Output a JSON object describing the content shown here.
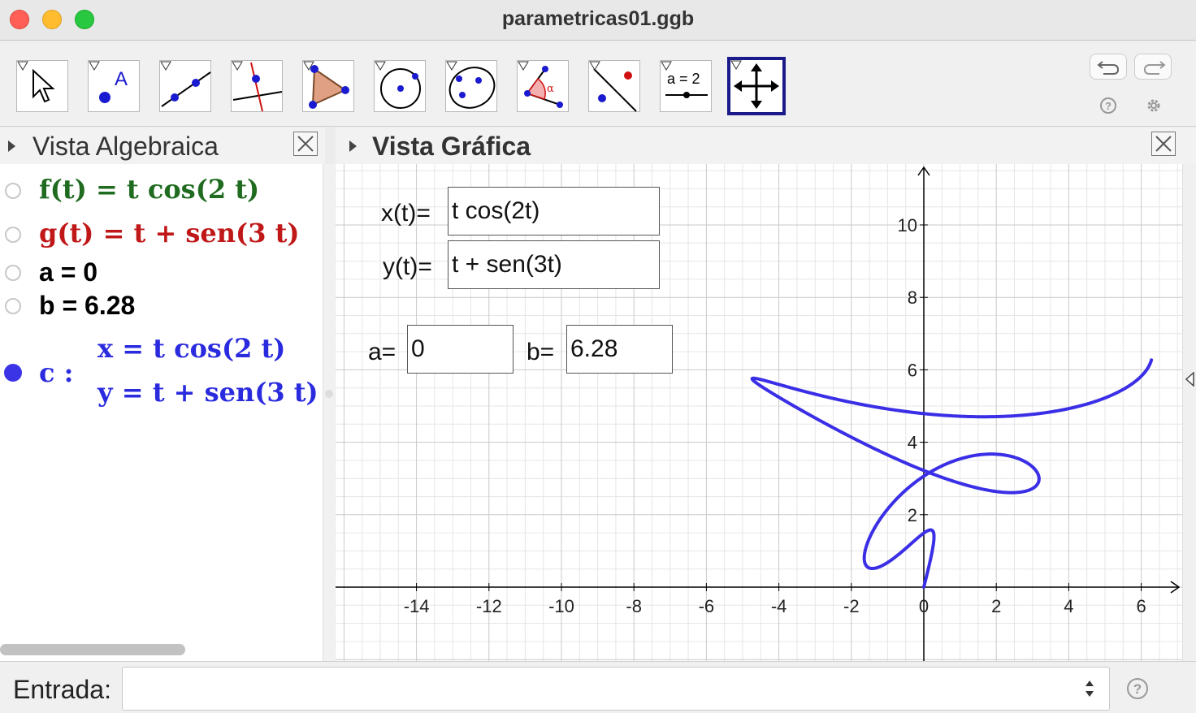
{
  "window": {
    "title": "parametricas01.ggb"
  },
  "toolbar": {
    "tools": [
      {
        "name": "move-tool",
        "selected": false
      },
      {
        "name": "point-tool",
        "selected": false
      },
      {
        "name": "line-tool",
        "selected": false
      },
      {
        "name": "perpendicular-line-tool",
        "selected": false
      },
      {
        "name": "polygon-tool",
        "selected": false
      },
      {
        "name": "circle-center-point-tool",
        "selected": false
      },
      {
        "name": "ellipse-tool",
        "selected": false
      },
      {
        "name": "angle-tool",
        "selected": false
      },
      {
        "name": "reflect-tool",
        "selected": false
      },
      {
        "name": "slider-tool",
        "selected": false
      },
      {
        "name": "move-graphics-view-tool",
        "selected": true
      }
    ],
    "slider_icon_text": "a = 2",
    "angle_icon_text": "α"
  },
  "algebra": {
    "title": "Vista Algebraica",
    "rows": [
      {
        "text": "f(t)  =  t  cos(2 t)",
        "color": "#1f6b1f"
      },
      {
        "text": "g(t)  =  t + sen(3 t)",
        "color": "#c01818"
      },
      {
        "text": "a = 0",
        "color": "#000000"
      },
      {
        "text": "b = 6.28",
        "color": "#000000"
      }
    ],
    "curve": {
      "label": "c :",
      "x": "x = t  cos(2 t)",
      "y": "y = t + sen(3 t)",
      "color": "#2a2adf"
    }
  },
  "graphics": {
    "title": "Vista Gráfica",
    "x_label": "x(t)=",
    "x_value": "t cos(2t)",
    "y_label": "y(t)=",
    "y_value": "t + sen(3t)",
    "a_label": "a=",
    "a_value": "0",
    "b_label": "b=",
    "b_value": "6.28",
    "x_ticks": [
      "-14",
      "-12",
      "-10",
      "-8",
      "-6",
      "-4",
      "-2",
      "0",
      "2",
      "4",
      "6"
    ],
    "y_ticks": [
      "2",
      "4",
      "6",
      "8",
      "10"
    ],
    "curve_color": "#3a2fe6",
    "t_range": [
      0,
      6.28
    ]
  },
  "input": {
    "label": "Entrada:",
    "value": ""
  }
}
